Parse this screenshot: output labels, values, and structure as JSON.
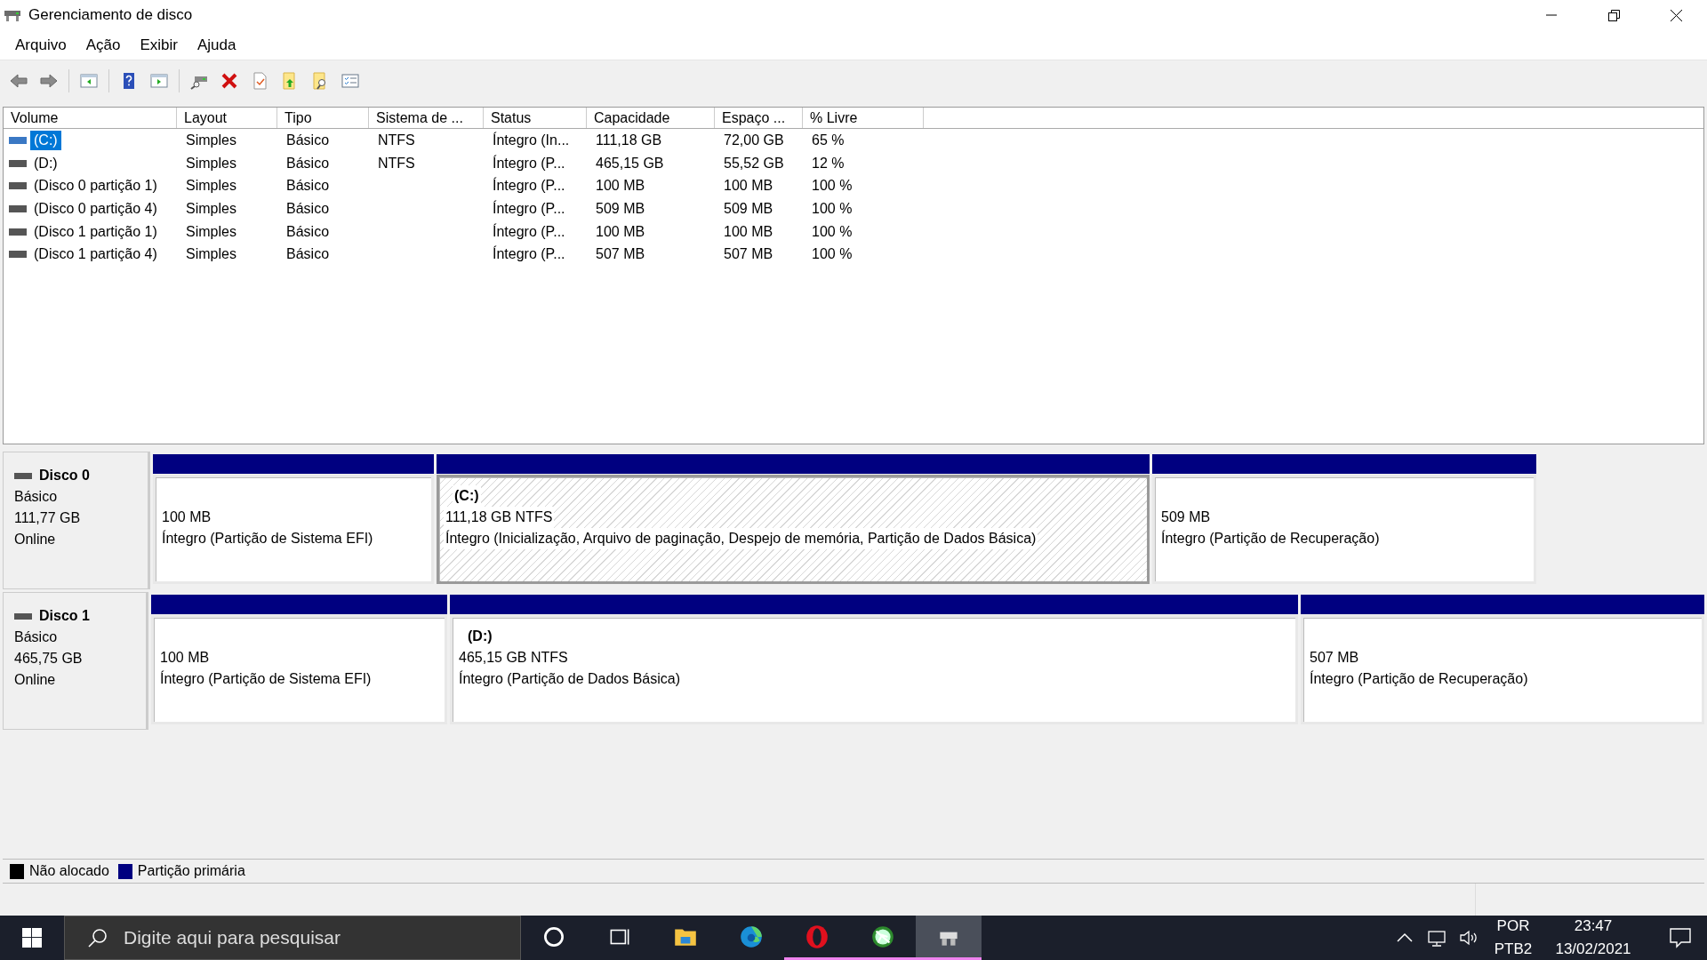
{
  "window": {
    "title": "Gerenciamento de disco"
  },
  "menu": [
    "Arquivo",
    "Ação",
    "Exibir",
    "Ajuda"
  ],
  "toolbar": [
    {
      "kind": "back",
      "disabled": false
    },
    {
      "kind": "forward",
      "disabled": false
    },
    {
      "kind": "sep"
    },
    {
      "kind": "pane-left"
    },
    {
      "kind": "sep"
    },
    {
      "kind": "help"
    },
    {
      "kind": "pane-right"
    },
    {
      "kind": "sep"
    },
    {
      "kind": "connect"
    },
    {
      "kind": "delete"
    },
    {
      "kind": "properties"
    },
    {
      "kind": "folder-up"
    },
    {
      "kind": "folder-search"
    },
    {
      "kind": "checklist"
    }
  ],
  "table": {
    "columns": [
      "Volume",
      "Layout",
      "Tipo",
      "Sistema de ...",
      "Status",
      "Capacidade",
      "Espaço ...",
      "% Livre"
    ],
    "rows": [
      {
        "selected": true,
        "cells": [
          "(C:)",
          "Simples",
          "Básico",
          "NTFS",
          "Íntegro (In...",
          "111,18 GB",
          "72,00 GB",
          "65 %"
        ]
      },
      {
        "selected": false,
        "cells": [
          "(D:)",
          "Simples",
          "Básico",
          "NTFS",
          "Íntegro (P...",
          "465,15 GB",
          "55,52 GB",
          "12 %"
        ]
      },
      {
        "selected": false,
        "cells": [
          "(Disco 0 partição 1)",
          "Simples",
          "Básico",
          "",
          "Íntegro (P...",
          "100 MB",
          "100 MB",
          "100 %"
        ]
      },
      {
        "selected": false,
        "cells": [
          "(Disco 0 partição 4)",
          "Simples",
          "Básico",
          "",
          "Íntegro (P...",
          "509 MB",
          "509 MB",
          "100 %"
        ]
      },
      {
        "selected": false,
        "cells": [
          "(Disco 1 partição 1)",
          "Simples",
          "Básico",
          "",
          "Íntegro (P...",
          "100 MB",
          "100 MB",
          "100 %"
        ]
      },
      {
        "selected": false,
        "cells": [
          "(Disco 1 partição 4)",
          "Simples",
          "Básico",
          "",
          "Íntegro (P...",
          "507 MB",
          "507 MB",
          "100 %"
        ]
      }
    ]
  },
  "disks": [
    {
      "name": "Disco 0",
      "type": "Básico",
      "size": "111,77 GB",
      "state": "Online",
      "partitions": [
        {
          "selected": false,
          "size": "100 MB",
          "status": "Íntegro (Partição de Sistema EFI)"
        },
        {
          "selected": true,
          "label": "(C:)",
          "size": "111,18 GB NTFS",
          "status": "Íntegro (Inicialização, Arquivo de paginação, Despejo de memória, Partição de Dados Básica)"
        },
        {
          "selected": false,
          "size": "509 MB",
          "status": "Íntegro (Partição de Recuperação)"
        }
      ]
    },
    {
      "name": "Disco 1",
      "type": "Básico",
      "size": "465,75 GB",
      "state": "Online",
      "partitions": [
        {
          "selected": false,
          "size": "100 MB",
          "status": "Íntegro (Partição de Sistema EFI)"
        },
        {
          "selected": false,
          "label": "(D:)",
          "size": "465,15 GB NTFS",
          "status": "Íntegro (Partição de Dados Básica)"
        },
        {
          "selected": false,
          "size": "507 MB",
          "status": "Íntegro (Partição de Recuperação)"
        }
      ]
    }
  ],
  "legend": [
    {
      "label": "Não alocado",
      "color": "#000000"
    },
    {
      "label": "Partição primária",
      "color": "#000080"
    }
  ],
  "taskbar": {
    "search": {
      "placeholder": "Digite aqui para pesquisar"
    },
    "apps": [
      {
        "kind": "cortana",
        "running": false,
        "active": false
      },
      {
        "kind": "taskview",
        "running": false,
        "active": false
      },
      {
        "kind": "explorer",
        "running": false,
        "active": false
      },
      {
        "kind": "edge",
        "running": false,
        "active": false
      },
      {
        "kind": "opera",
        "running": true,
        "active": false
      },
      {
        "kind": "game",
        "running": true,
        "active": false
      },
      {
        "kind": "disk",
        "running": true,
        "active": true
      }
    ],
    "language": [
      "POR",
      "PTB2"
    ],
    "time": "23:47",
    "date": "13/02/2021"
  }
}
